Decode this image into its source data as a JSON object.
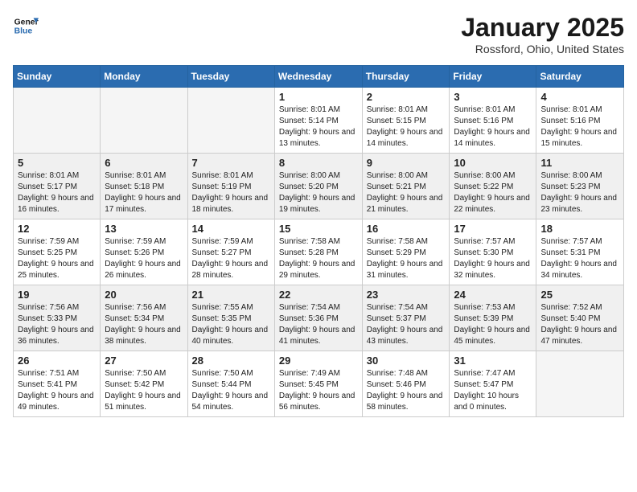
{
  "header": {
    "logo_line1": "General",
    "logo_line2": "Blue",
    "title": "January 2025",
    "subtitle": "Rossford, Ohio, United States"
  },
  "weekdays": [
    "Sunday",
    "Monday",
    "Tuesday",
    "Wednesday",
    "Thursday",
    "Friday",
    "Saturday"
  ],
  "weeks": [
    [
      {
        "day": "",
        "empty": true
      },
      {
        "day": "",
        "empty": true
      },
      {
        "day": "",
        "empty": true
      },
      {
        "day": "1",
        "detail": "Sunrise: 8:01 AM\nSunset: 5:14 PM\nDaylight: 9 hours and 13 minutes."
      },
      {
        "day": "2",
        "detail": "Sunrise: 8:01 AM\nSunset: 5:15 PM\nDaylight: 9 hours and 14 minutes."
      },
      {
        "day": "3",
        "detail": "Sunrise: 8:01 AM\nSunset: 5:16 PM\nDaylight: 9 hours and 14 minutes."
      },
      {
        "day": "4",
        "detail": "Sunrise: 8:01 AM\nSunset: 5:16 PM\nDaylight: 9 hours and 15 minutes."
      }
    ],
    [
      {
        "day": "5",
        "detail": "Sunrise: 8:01 AM\nSunset: 5:17 PM\nDaylight: 9 hours and 16 minutes."
      },
      {
        "day": "6",
        "detail": "Sunrise: 8:01 AM\nSunset: 5:18 PM\nDaylight: 9 hours and 17 minutes."
      },
      {
        "day": "7",
        "detail": "Sunrise: 8:01 AM\nSunset: 5:19 PM\nDaylight: 9 hours and 18 minutes."
      },
      {
        "day": "8",
        "detail": "Sunrise: 8:00 AM\nSunset: 5:20 PM\nDaylight: 9 hours and 19 minutes."
      },
      {
        "day": "9",
        "detail": "Sunrise: 8:00 AM\nSunset: 5:21 PM\nDaylight: 9 hours and 21 minutes."
      },
      {
        "day": "10",
        "detail": "Sunrise: 8:00 AM\nSunset: 5:22 PM\nDaylight: 9 hours and 22 minutes."
      },
      {
        "day": "11",
        "detail": "Sunrise: 8:00 AM\nSunset: 5:23 PM\nDaylight: 9 hours and 23 minutes."
      }
    ],
    [
      {
        "day": "12",
        "detail": "Sunrise: 7:59 AM\nSunset: 5:25 PM\nDaylight: 9 hours and 25 minutes."
      },
      {
        "day": "13",
        "detail": "Sunrise: 7:59 AM\nSunset: 5:26 PM\nDaylight: 9 hours and 26 minutes."
      },
      {
        "day": "14",
        "detail": "Sunrise: 7:59 AM\nSunset: 5:27 PM\nDaylight: 9 hours and 28 minutes."
      },
      {
        "day": "15",
        "detail": "Sunrise: 7:58 AM\nSunset: 5:28 PM\nDaylight: 9 hours and 29 minutes."
      },
      {
        "day": "16",
        "detail": "Sunrise: 7:58 AM\nSunset: 5:29 PM\nDaylight: 9 hours and 31 minutes."
      },
      {
        "day": "17",
        "detail": "Sunrise: 7:57 AM\nSunset: 5:30 PM\nDaylight: 9 hours and 32 minutes."
      },
      {
        "day": "18",
        "detail": "Sunrise: 7:57 AM\nSunset: 5:31 PM\nDaylight: 9 hours and 34 minutes."
      }
    ],
    [
      {
        "day": "19",
        "detail": "Sunrise: 7:56 AM\nSunset: 5:33 PM\nDaylight: 9 hours and 36 minutes."
      },
      {
        "day": "20",
        "detail": "Sunrise: 7:56 AM\nSunset: 5:34 PM\nDaylight: 9 hours and 38 minutes."
      },
      {
        "day": "21",
        "detail": "Sunrise: 7:55 AM\nSunset: 5:35 PM\nDaylight: 9 hours and 40 minutes."
      },
      {
        "day": "22",
        "detail": "Sunrise: 7:54 AM\nSunset: 5:36 PM\nDaylight: 9 hours and 41 minutes."
      },
      {
        "day": "23",
        "detail": "Sunrise: 7:54 AM\nSunset: 5:37 PM\nDaylight: 9 hours and 43 minutes."
      },
      {
        "day": "24",
        "detail": "Sunrise: 7:53 AM\nSunset: 5:39 PM\nDaylight: 9 hours and 45 minutes."
      },
      {
        "day": "25",
        "detail": "Sunrise: 7:52 AM\nSunset: 5:40 PM\nDaylight: 9 hours and 47 minutes."
      }
    ],
    [
      {
        "day": "26",
        "detail": "Sunrise: 7:51 AM\nSunset: 5:41 PM\nDaylight: 9 hours and 49 minutes."
      },
      {
        "day": "27",
        "detail": "Sunrise: 7:50 AM\nSunset: 5:42 PM\nDaylight: 9 hours and 51 minutes."
      },
      {
        "day": "28",
        "detail": "Sunrise: 7:50 AM\nSunset: 5:44 PM\nDaylight: 9 hours and 54 minutes."
      },
      {
        "day": "29",
        "detail": "Sunrise: 7:49 AM\nSunset: 5:45 PM\nDaylight: 9 hours and 56 minutes."
      },
      {
        "day": "30",
        "detail": "Sunrise: 7:48 AM\nSunset: 5:46 PM\nDaylight: 9 hours and 58 minutes."
      },
      {
        "day": "31",
        "detail": "Sunrise: 7:47 AM\nSunset: 5:47 PM\nDaylight: 10 hours and 0 minutes."
      },
      {
        "day": "",
        "empty": true
      }
    ]
  ]
}
